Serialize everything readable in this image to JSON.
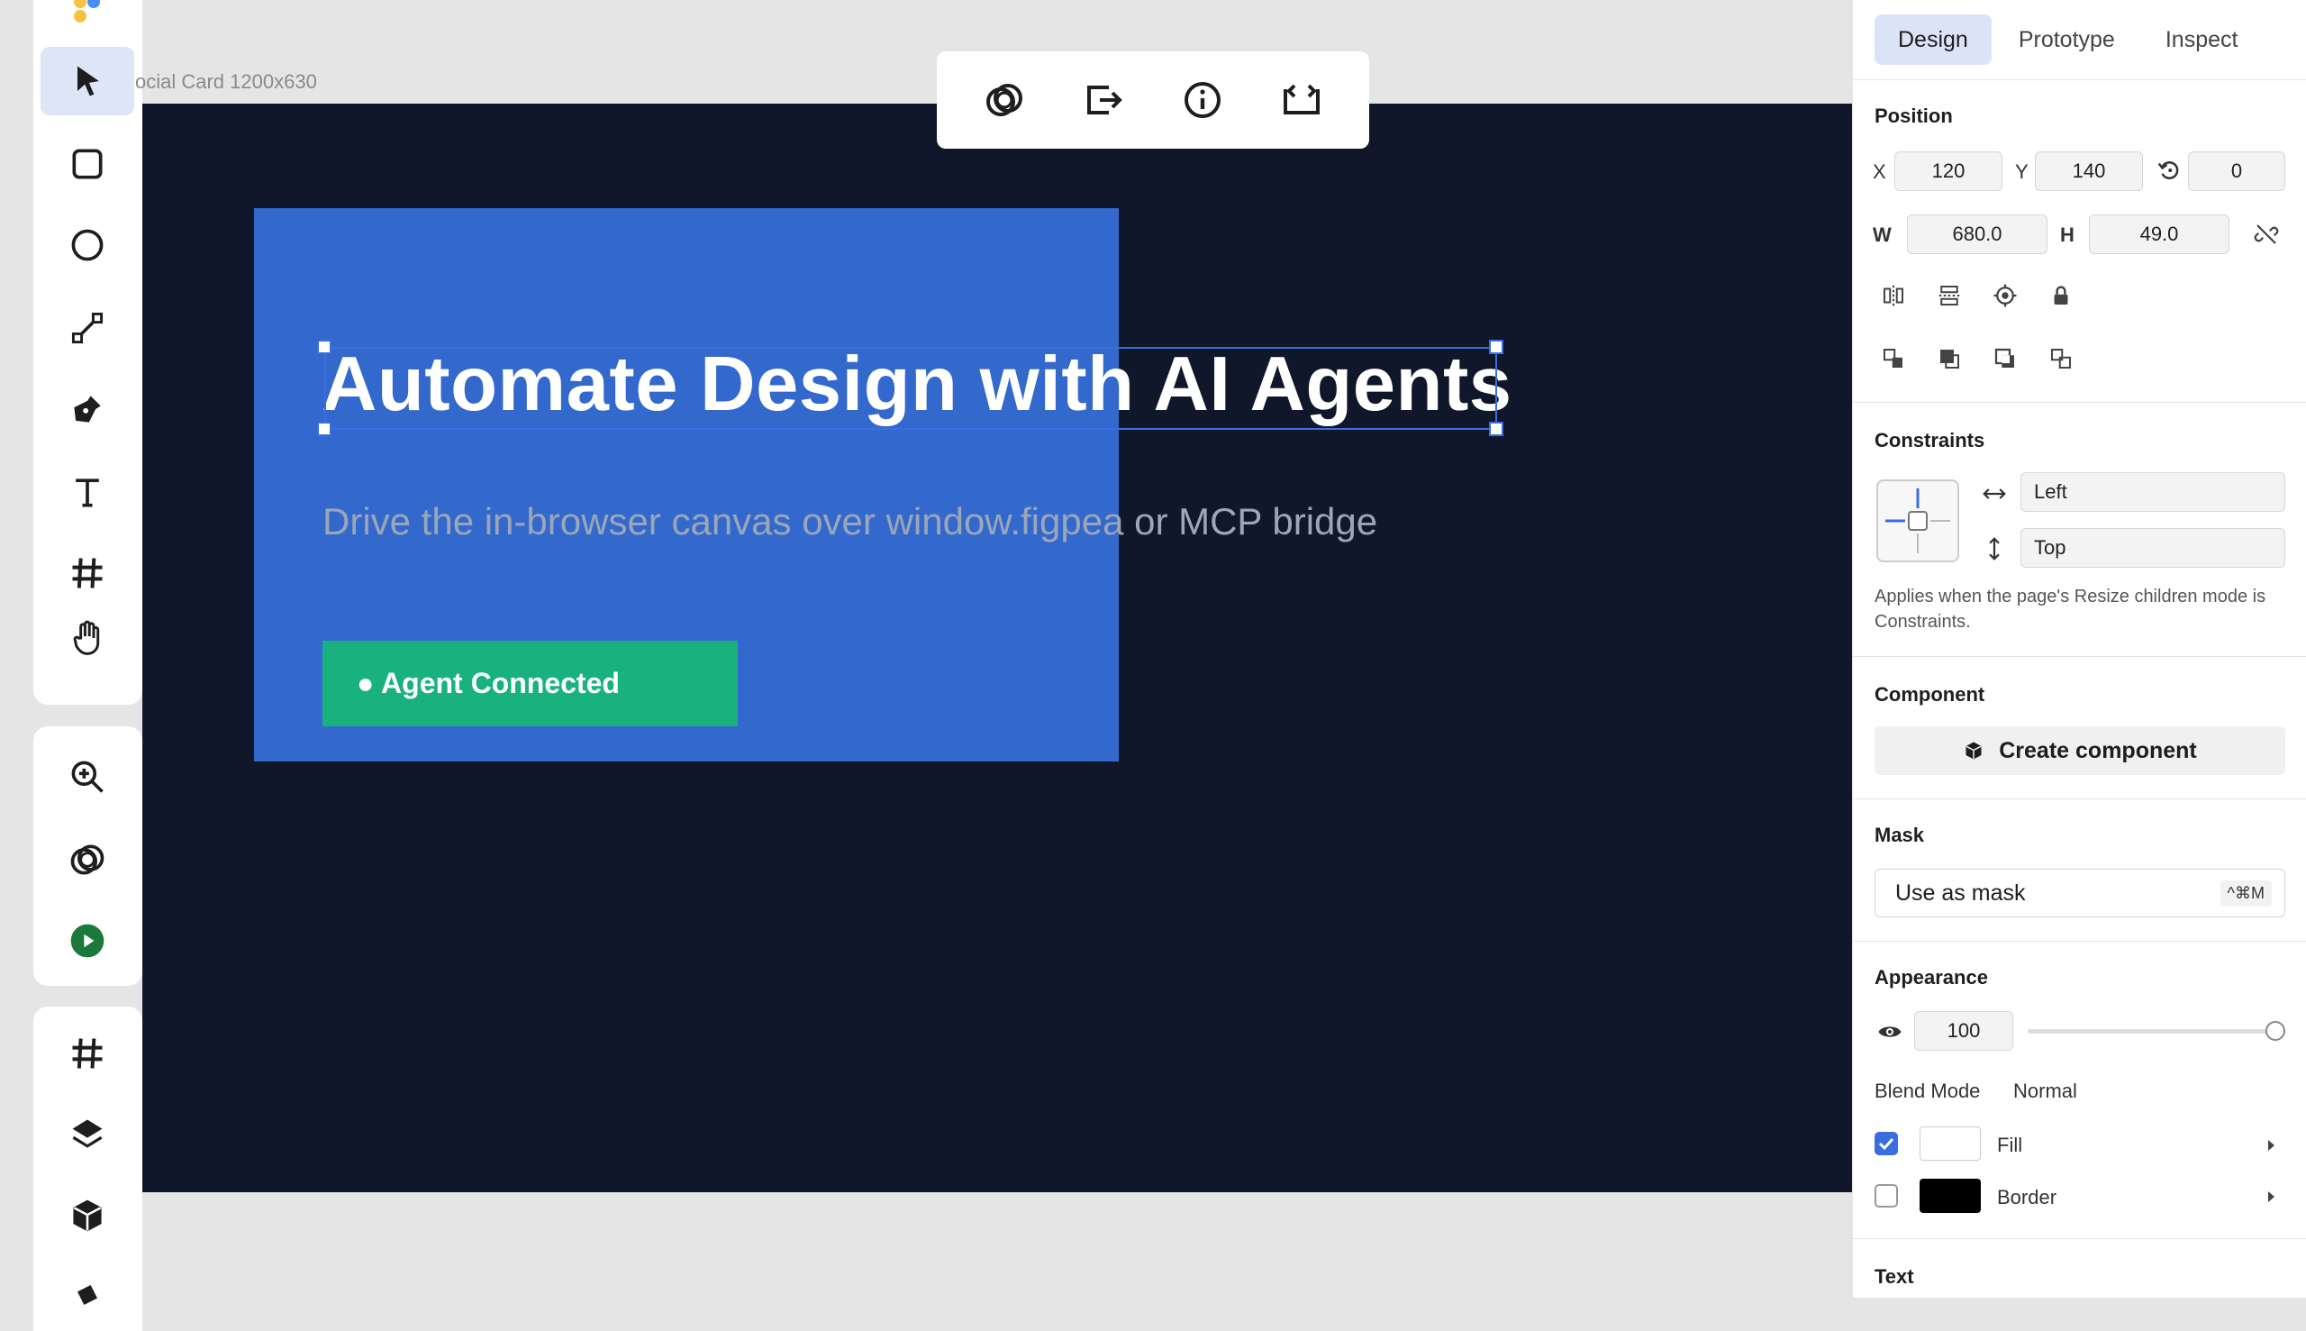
{
  "canvas": {
    "frame_label": "ocial Card 1200x630",
    "headline": "Automate Design with AI Agents",
    "subline": "Drive the in-browser canvas over window.figpea or MCP bridge",
    "cta_label": "● Agent Connected"
  },
  "panel": {
    "tabs": [
      "Design",
      "Prototype",
      "Inspect"
    ],
    "position": {
      "title": "Position",
      "x_label": "X",
      "x": "120",
      "y_label": "Y",
      "y": "140",
      "rotation": "0",
      "w_label": "W",
      "w": "680.0",
      "h_label": "H",
      "h": "49.0"
    },
    "constraints": {
      "title": "Constraints",
      "horizontal": "Left",
      "vertical": "Top",
      "note": "Applies when the page's Resize children mode is Constraints."
    },
    "component": {
      "title": "Component",
      "button": "Create component"
    },
    "mask": {
      "title": "Mask",
      "label": "Use as mask",
      "shortcut": "^⌘M"
    },
    "appearance": {
      "title": "Appearance",
      "opacity": "100",
      "blend_label": "Blend Mode",
      "blend_value": "Normal",
      "fill_label": "Fill",
      "border_label": "Border",
      "fill_enabled": true,
      "border_enabled": false
    },
    "text_title": "Text"
  },
  "colors": {
    "accent": "#3c6de0",
    "frame_bg": "#10172a",
    "blue_rect": "#3369cc",
    "cta_green": "#19b27f",
    "play_green": "#1a7a3c"
  }
}
